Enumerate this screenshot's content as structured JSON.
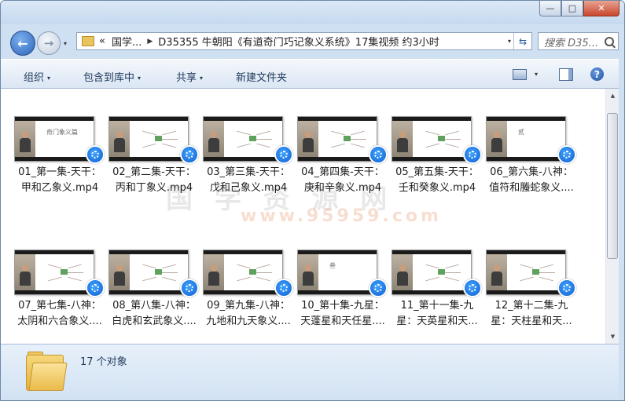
{
  "window": {
    "minimize_glyph": "—",
    "maximize_glyph": "□",
    "close_glyph": "✕"
  },
  "nav": {
    "back_glyph": "←",
    "forward_glyph": "→",
    "dropdown_glyph": "▾"
  },
  "address": {
    "overflow": "«",
    "crumb1": "国学...",
    "crumb2": "D35355 牛朝阳《有道奇门巧记象义系统》17集视频 约3小时",
    "dropdown_glyph": "▾",
    "refresh_glyph": "⇆"
  },
  "search": {
    "placeholder": "搜索 D35..."
  },
  "toolbar": {
    "organize": "组织",
    "include_in_library": "包含到库中",
    "share": "共享",
    "new_folder": "新建文件夹",
    "arrow": "▾",
    "help_glyph": "?"
  },
  "scrollbar": {
    "up_glyph": "▲",
    "down_glyph": "▼"
  },
  "watermark": {
    "text_main": "国 学 资 源 网",
    "text_url": "www.95959.com"
  },
  "files": [
    {
      "line1": "01_第一集-天干：",
      "line2": "甲和乙象义.mp4",
      "thumb_label": "奇门象义篇"
    },
    {
      "line1": "02_第二集-天干：",
      "line2": "丙和丁象义.mp4",
      "thumb_label": ""
    },
    {
      "line1": "03_第三集-天干：",
      "line2": "戊和己象义.mp4",
      "thumb_label": ""
    },
    {
      "line1": "04_第四集-天干：",
      "line2": "庚和辛象义.mp4",
      "thumb_label": ""
    },
    {
      "line1": "05_第五集-天干：",
      "line2": "壬和癸象义.mp4",
      "thumb_label": ""
    },
    {
      "line1": "06_第六集-八神：",
      "line2": "值符和螣蛇象义....",
      "thumb_label": "贰"
    },
    {
      "line1": "07_第七集-八神：",
      "line2": "太阴和六合象义....",
      "thumb_label": ""
    },
    {
      "line1": "08_第八集-八神：",
      "line2": "白虎和玄武象义....",
      "thumb_label": ""
    },
    {
      "line1": "09_第九集-八神：",
      "line2": "九地和九天象义....",
      "thumb_label": ""
    },
    {
      "line1": "10_第十集-九星：",
      "line2": "天蓬星和天任星....",
      "thumb_label": "叁"
    },
    {
      "line1": "11_第十一集-九",
      "line2": "星：天英星和天...",
      "thumb_label": ""
    },
    {
      "line1": "12_第十二集-九",
      "line2": "星：天柱星和天...",
      "thumb_label": ""
    }
  ],
  "status": {
    "count_text": "17 个对象"
  }
}
